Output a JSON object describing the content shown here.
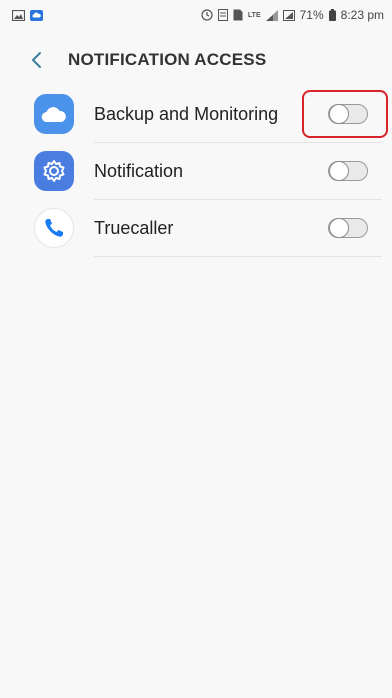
{
  "status_bar": {
    "battery_percent": "71%",
    "time": "8:23 pm",
    "network_label": "LTE"
  },
  "header": {
    "title": "NOTIFICATION ACCESS"
  },
  "apps": [
    {
      "label": "Backup and Monitoring",
      "enabled": false,
      "icon": "cloud-icon"
    },
    {
      "label": "Notification",
      "enabled": false,
      "icon": "gear-icon"
    },
    {
      "label": "Truecaller",
      "enabled": false,
      "icon": "phone-icon"
    }
  ],
  "colors": {
    "highlight": "#d8232a",
    "backup_icon_bg": "#4a92ea",
    "notification_icon_bg": "#4a7de0",
    "truecaller_phone": "#1a7cf2"
  }
}
